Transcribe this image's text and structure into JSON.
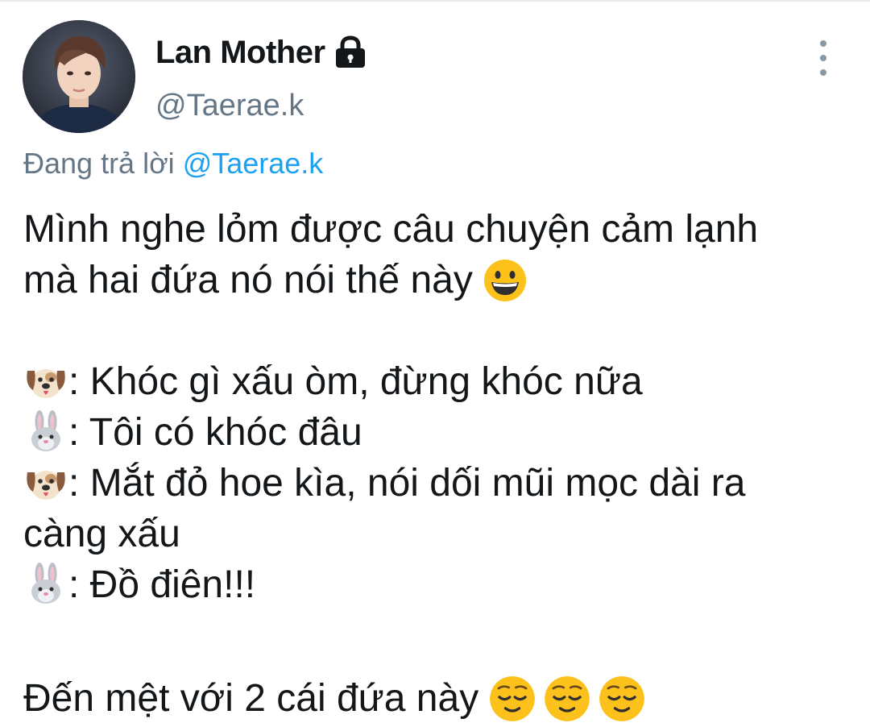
{
  "author": {
    "display_name": "Lan Mother",
    "handle": "@Taerae.k",
    "protected_icon": "lock-icon",
    "avatar": "profile-photo"
  },
  "actions": {
    "more_icon": "more-vertical-icon"
  },
  "reply": {
    "prefix": "Đang trả lời ",
    "mention": "@Taerae.k"
  },
  "tweet": {
    "line1": "Mình nghe lỏm được câu chuyện cảm lạnh",
    "line2": "mà hai đứa nó nói thế này",
    "line2_emoji": "grinning-face-emoji",
    "d1_speaker": "dog-face-emoji",
    "d1_text": ": Khóc gì xấu òm, đừng khóc nữa",
    "d2_speaker": "rabbit-face-emoji",
    "d2_text": ": Tôi có khóc đâu",
    "d3_speaker": "dog-face-emoji",
    "d3_text": ": Mắt đỏ hoe kìa, nói dối mũi mọc dài ra",
    "d3_cont": "càng xấu",
    "d4_speaker": "rabbit-face-emoji",
    "d4_text": ": Đồ điên!!!",
    "closing": "Đến mệt với 2 cái đứa này",
    "closing_emojis": [
      "relieved-face-emoji",
      "relieved-face-emoji",
      "relieved-face-emoji"
    ]
  },
  "colors": {
    "text": "#14171a",
    "secondary": "#657786",
    "link": "#1da1f2"
  }
}
